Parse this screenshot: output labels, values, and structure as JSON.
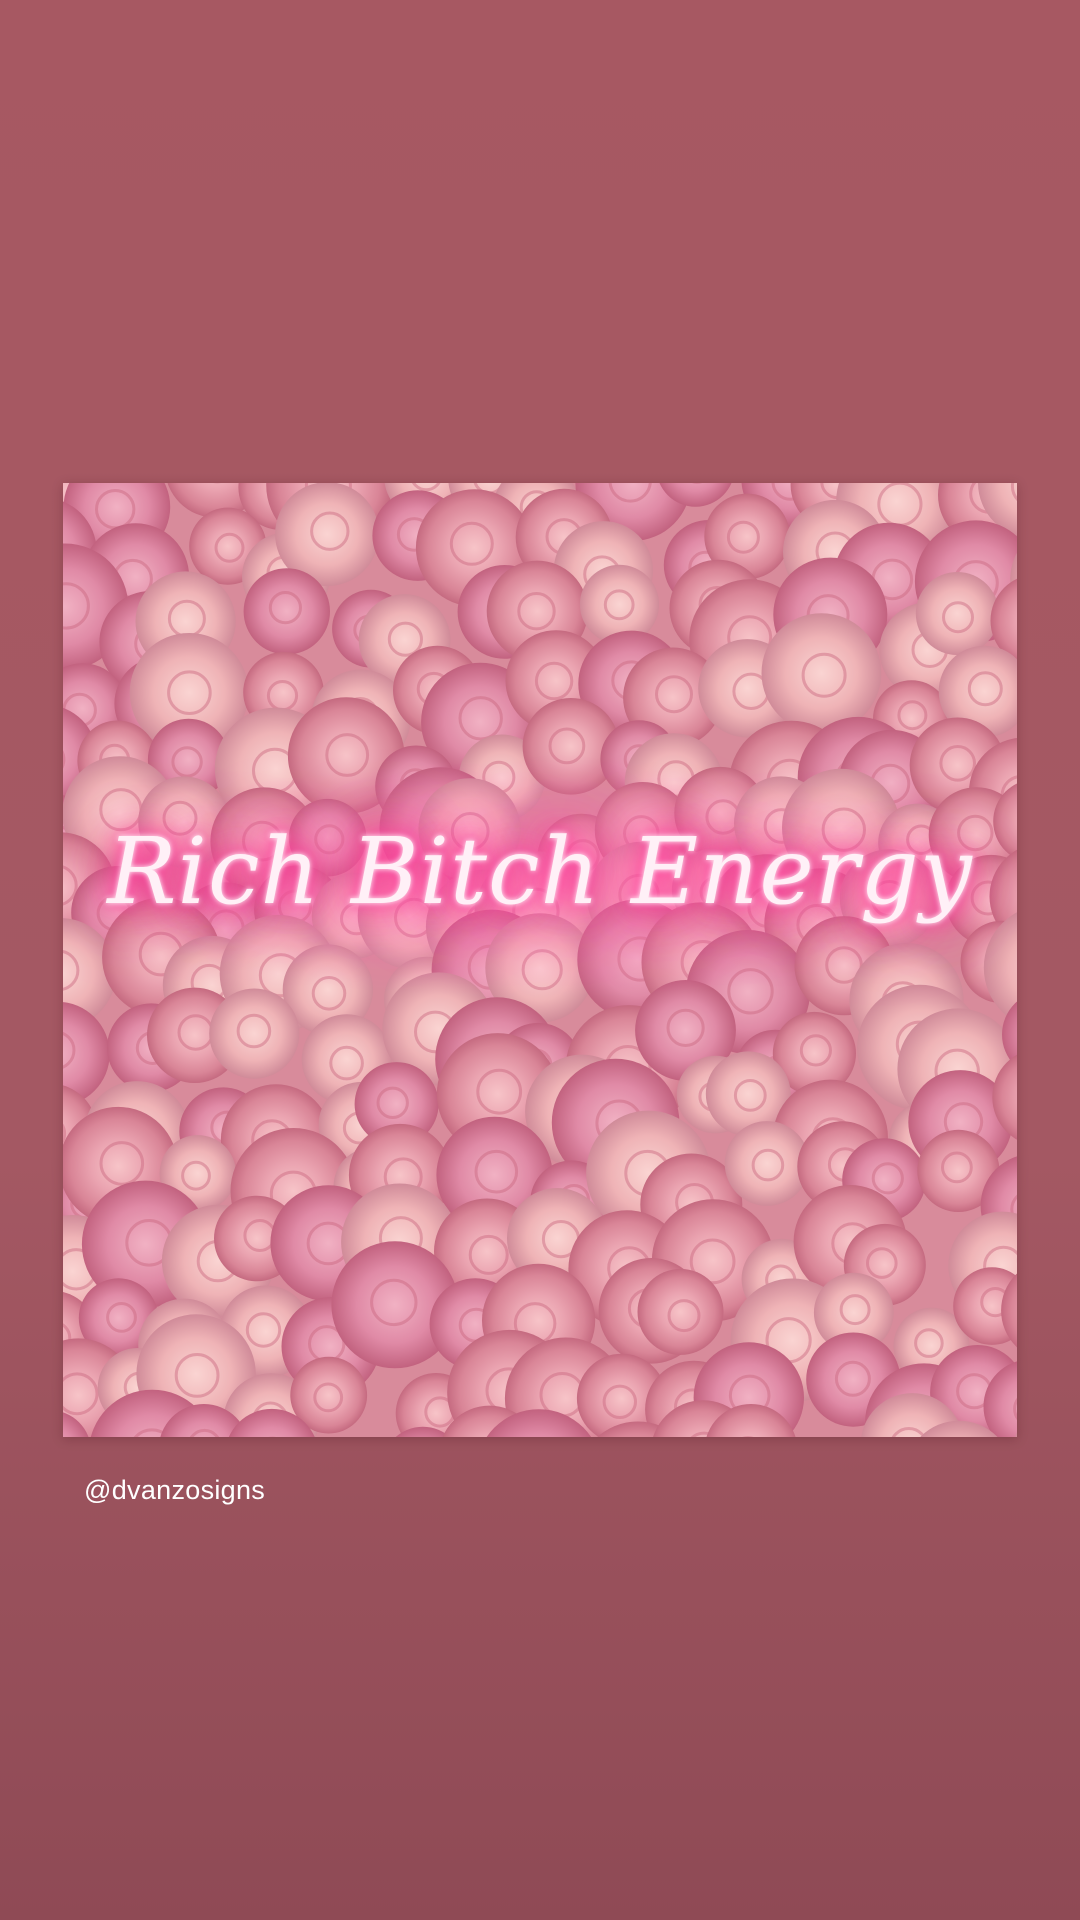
{
  "post": {
    "neon_sign_text": "Rich Bitch Energy",
    "neon_color": "#ff3d9a",
    "background_color": "#a75862",
    "photo_description_icon": "flower-wall-icon"
  },
  "mention": {
    "handle": "@dvanzosigns"
  }
}
